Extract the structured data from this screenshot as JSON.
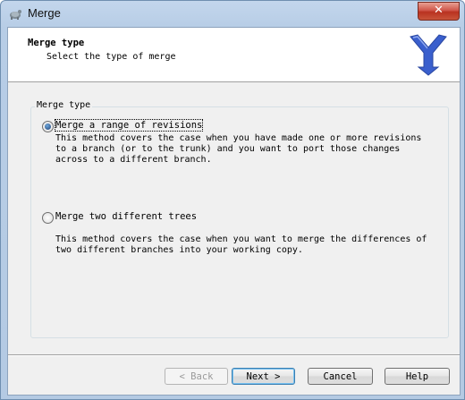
{
  "window": {
    "title": "Merge",
    "close_label": "✕"
  },
  "header": {
    "title": "Merge type",
    "subtitle": "Select the type of merge"
  },
  "group": {
    "label": "Merge type"
  },
  "options": [
    {
      "label": "Merge a range of revisions",
      "selected": true,
      "description": "This method covers the case when you have made one or more revisions\nto a branch (or to the trunk) and you want to port those changes\nacross to a different branch."
    },
    {
      "label": "Merge two different trees",
      "selected": false,
      "description": "This method covers the case when you want to merge the differences of\ntwo different branches into your working copy."
    }
  ],
  "buttons": {
    "back": "< Back",
    "next": "Next >",
    "cancel": "Cancel",
    "help": "Help"
  },
  "colors": {
    "accent": "#3a5fcd",
    "logo": "#3a5fcd"
  }
}
